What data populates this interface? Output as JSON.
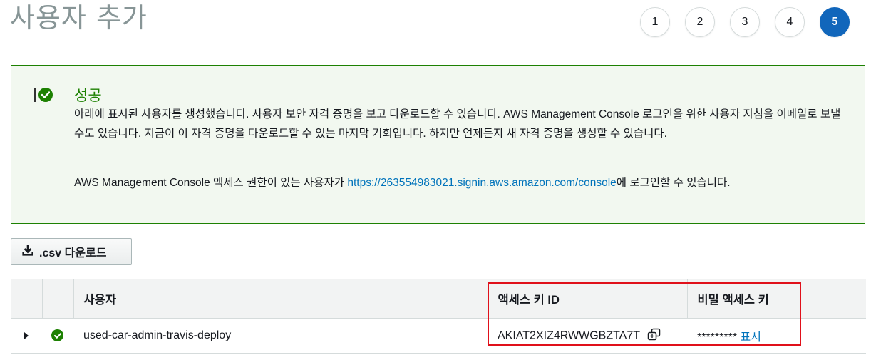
{
  "page": {
    "title": "사용자 추가"
  },
  "wizard": {
    "steps": [
      "1",
      "2",
      "3",
      "4",
      "5"
    ],
    "active_step": "5",
    "active_color": "#1166bb"
  },
  "success": {
    "title": "성공",
    "icon": "check-circle-icon",
    "color": "#1d8102",
    "message": "아래에 표시된 사용자를 생성했습니다. 사용자 보안 자격 증명을 보고 다운로드할 수 있습니다. AWS Management Console 로그인을 위한 사용자 지침을 이메일로 보낼 수도 있습니다. 지금이 이 자격 증명을 다운로드할 수 있는 마지막 기회입니다. 하지만 언제든지 새 자격 증명을 생성할 수 있습니다.",
    "console_prefix": "AWS Management Console 액세스 권한이 있는 사용자가 ",
    "console_url": "https://263554983021.signin.aws.amazon.com/console",
    "console_suffix": "에 로그인할 수 있습니다."
  },
  "toolbar": {
    "download_label": ".csv 다운로드",
    "download_icon": "download-icon"
  },
  "table": {
    "headers": {
      "user": "사용자",
      "access_key_id": "액세스 키 ID",
      "secret_key": "비밀 액세스 키"
    },
    "rows": [
      {
        "status_icon": "check-circle-icon",
        "user": "used-car-admin-travis-deploy",
        "access_key_id": "AKIAT2XIZ4RWWGBZTA7T",
        "secret_masked": "*********",
        "show_label": "표시"
      }
    ]
  },
  "colors": {
    "link": "#0073bb",
    "highlight": "#e0101a",
    "panel_bg": "#f2f8f0"
  }
}
